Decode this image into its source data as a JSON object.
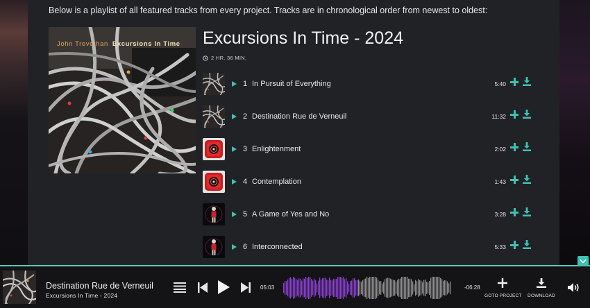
{
  "intro_text": "Below is a playlist of all featured tracks from every project. Tracks are in chronological order from newest to oldest:",
  "album": {
    "cover_artist": "John Trevethan",
    "cover_title": "Excursions In Time",
    "title": "Excursions In Time - 2024",
    "duration": "2 HR. 36 MIN."
  },
  "tracks": [
    {
      "number": "1",
      "title": "In Pursuit of Everything",
      "length": "5:40",
      "art": "cables"
    },
    {
      "number": "2",
      "title": "Destination Rue de Verneuil",
      "length": "11:32",
      "art": "cables"
    },
    {
      "number": "3",
      "title": "Enlightenment",
      "length": "2:02",
      "art": "red-emblem"
    },
    {
      "number": "4",
      "title": "Contemplation",
      "length": "1:43",
      "art": "red-emblem"
    },
    {
      "number": "5",
      "title": "A Game of Yes and No",
      "length": "3:28",
      "art": "dark-figure"
    },
    {
      "number": "6",
      "title": "Interconnected",
      "length": "5:33",
      "art": "dark-figure"
    }
  ],
  "player": {
    "now_playing_title": "Destination Rue de Verneuil",
    "now_playing_album": "Excursions In Time - 2024",
    "elapsed": "05:03",
    "remaining": "-06:28",
    "progress": 0.44,
    "goto_label": "GOTO PROJECT",
    "download_label": "DOWNLOAD"
  },
  "colors": {
    "accent": "#3ec1b4",
    "wave_played": "#8a3fd1",
    "wave_unplayed": "#8c8c8c",
    "panel": "#212226"
  },
  "icons": [
    "clock-icon",
    "play-icon",
    "plus-icon",
    "download-icon",
    "playlist-icon",
    "prev-icon",
    "next-icon",
    "volume-icon",
    "chevron-down-icon"
  ]
}
